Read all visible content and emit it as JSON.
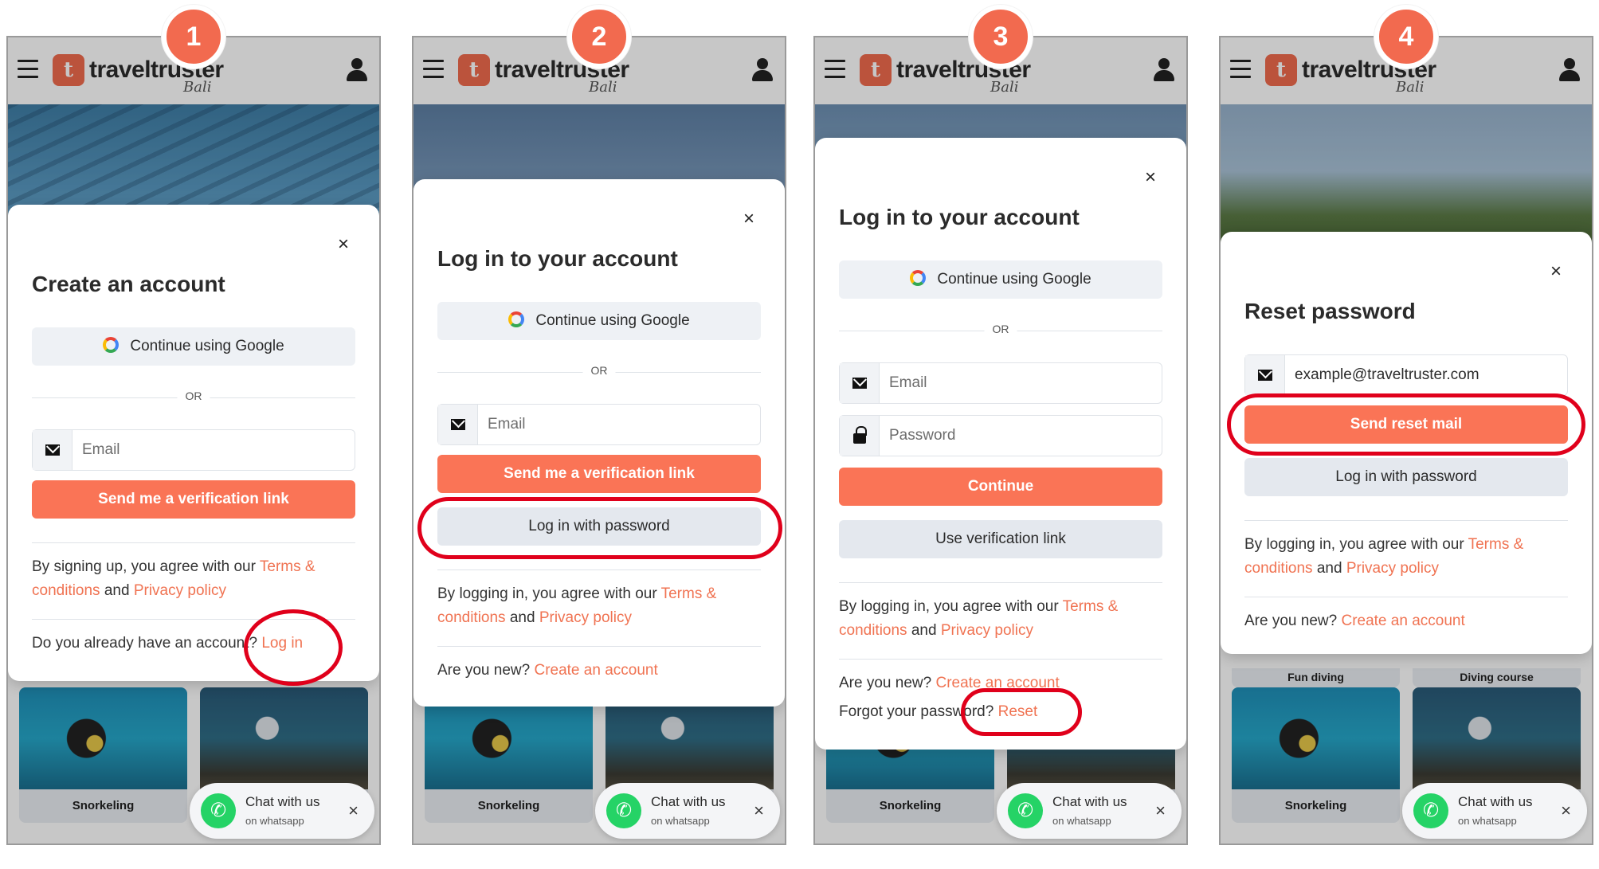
{
  "colors": {
    "accent": "#fa7456",
    "link": "#f07352",
    "highlight": "#e0001b",
    "whatsapp": "#25d366"
  },
  "common": {
    "logo_text": "traveltruster",
    "logo_sub": "Bali",
    "logo_glyph": "t",
    "tile_left_label": "Snorkeling",
    "tile_right_label": "",
    "whatsapp_title": "Chat with us",
    "whatsapp_sub": "on whatsapp",
    "close_symbol": "×",
    "google_label": "Continue using Google",
    "or_label": "OR",
    "email_placeholder": "Email",
    "password_placeholder": "Password"
  },
  "screens": [
    {
      "step": "1",
      "title": "Create an account",
      "primary_button": "Send me a verification link",
      "legal_prefix": "By signing up, you agree with our ",
      "legal_terms": "Terms & conditions",
      "legal_and": " and ",
      "legal_privacy": "Privacy policy",
      "footer_prefix": "Do you already have an account? ",
      "footer_link": "Log in"
    },
    {
      "step": "2",
      "title": "Log in to your account",
      "primary_button": "Send me a verification link",
      "secondary_button": "Log in with password",
      "legal_prefix": "By logging in, you agree with our ",
      "legal_terms": "Terms & conditions",
      "legal_and": " and ",
      "legal_privacy": "Privacy policy",
      "footer_prefix": "Are you new? ",
      "footer_link": "Create an account"
    },
    {
      "step": "3",
      "title": "Log in to your account",
      "primary_button": "Continue",
      "secondary_button": "Use verification link",
      "legal_prefix": "By logging in, you agree with our ",
      "legal_terms": "Terms & conditions",
      "legal_and": " and ",
      "legal_privacy": "Privacy policy",
      "footer_prefix": "Are you new? ",
      "footer_link": "Create an account",
      "forgot_prefix": "Forgot your password? ",
      "forgot_link": "Reset"
    },
    {
      "step": "4",
      "title": "Reset password",
      "email_value": "example@traveltruster.com",
      "primary_button": "Send reset mail",
      "secondary_button": "Log in with password",
      "legal_prefix": "By logging in, you agree with our ",
      "legal_terms": "Terms & conditions",
      "legal_and": " and ",
      "legal_privacy": "Privacy policy",
      "footer_prefix": "Are you new? ",
      "footer_link": "Create an account",
      "top_label_left": "Fun diving",
      "top_label_right": "Diving course"
    }
  ]
}
